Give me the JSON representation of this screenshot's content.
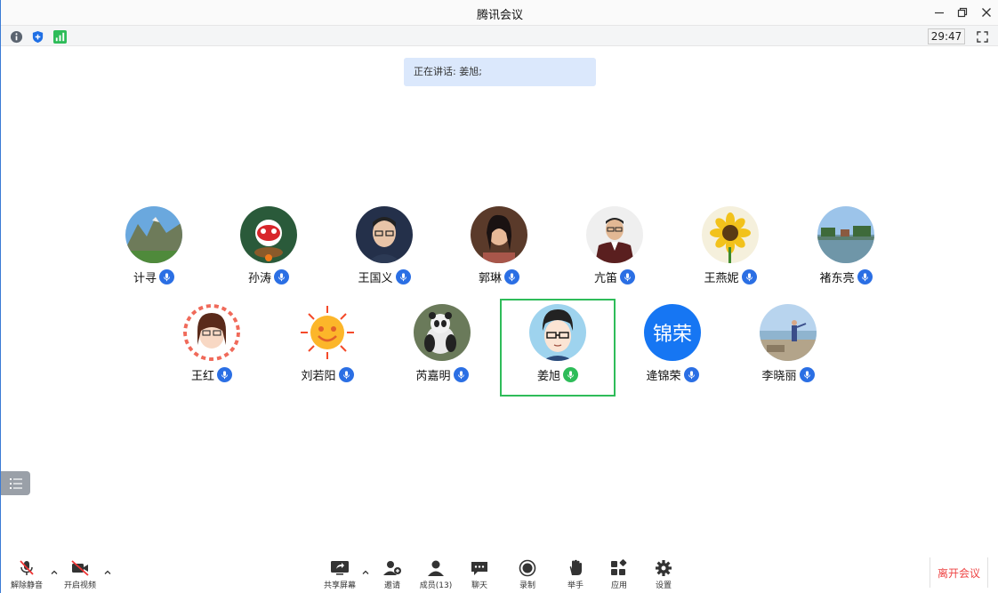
{
  "window": {
    "title": "腾讯会议"
  },
  "infobar": {
    "timer": "29:47"
  },
  "speaking": {
    "text": "正在讲话: 姜旭;"
  },
  "participants": [
    {
      "name": "计寻",
      "mic": "blue"
    },
    {
      "name": "孙涛",
      "mic": "blue"
    },
    {
      "name": "王国义",
      "mic": "blue"
    },
    {
      "name": "郭琳",
      "mic": "blue"
    },
    {
      "name": "亢笛",
      "mic": "blue"
    },
    {
      "name": "王燕妮",
      "mic": "blue"
    },
    {
      "name": "褚东亮",
      "mic": "blue"
    },
    {
      "name": "王红",
      "mic": "blue"
    },
    {
      "name": "刘若阳",
      "mic": "blue"
    },
    {
      "name": "芮嘉明",
      "mic": "blue"
    },
    {
      "name": "姜旭",
      "mic": "green",
      "active": true
    },
    {
      "name": "逄锦荣",
      "mic": "blue",
      "avatar_text": "锦荣"
    },
    {
      "name": "李晓丽",
      "mic": "blue"
    }
  ],
  "toolbar": {
    "unmute": "解除静音",
    "video": "开启视频",
    "share": "共享屏幕",
    "invite": "邀请",
    "members": "成员(13)",
    "chat": "聊天",
    "record": "录制",
    "raise_hand": "举手",
    "apps": "应用",
    "settings": "设置",
    "leave": "离开会议"
  },
  "colors": {
    "accent": "#2b6fe4",
    "speaking_bg": "#dbe8fc",
    "active_border": "#2ebc59",
    "leave": "#e44444"
  }
}
